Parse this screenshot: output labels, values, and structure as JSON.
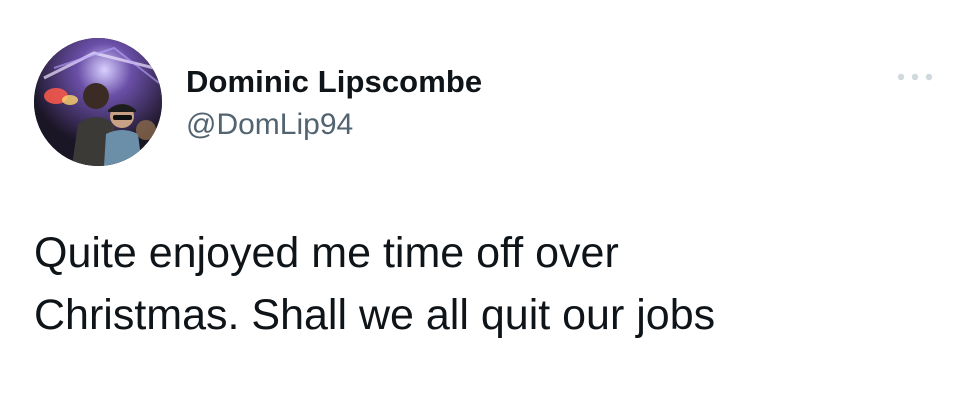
{
  "tweet": {
    "author": {
      "display_name": "Dominic Lipscombe",
      "handle": "@DomLip94",
      "avatar_icon": "profile-photo-avatar"
    },
    "more_icon": "more-horizontal-icon",
    "text": "Quite enjoyed me time off over\nChristmas. Shall we all quit our jobs"
  },
  "colors": {
    "background": "#ffffff",
    "primary_text": "#0f1419",
    "secondary_text": "#536471"
  }
}
